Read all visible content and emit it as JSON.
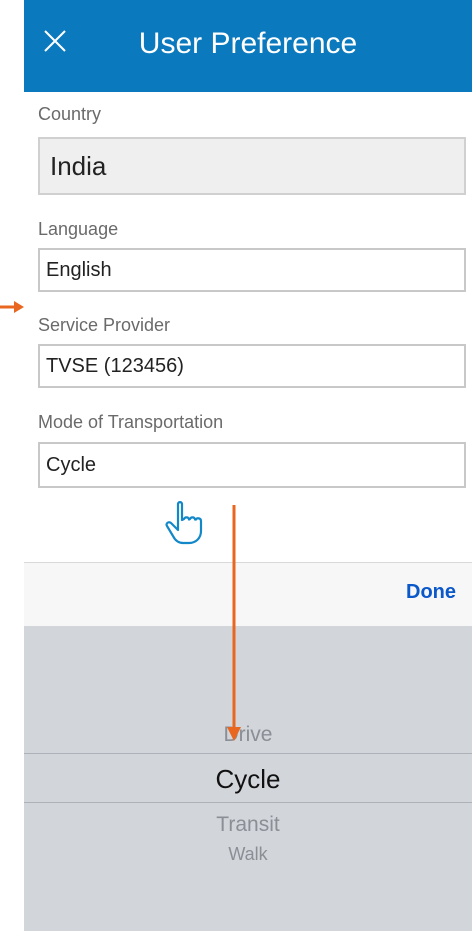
{
  "header": {
    "title": "User Preference",
    "close_icon": "close-icon"
  },
  "form": {
    "country": {
      "label": "Country",
      "value": "India"
    },
    "language": {
      "label": "Language",
      "value": "English"
    },
    "service_provider": {
      "label": "Service Provider",
      "value": "TVSE (123456)"
    },
    "transport": {
      "label": "Mode of Transportation",
      "value": "Cycle"
    }
  },
  "toolbar": {
    "done_label": "Done"
  },
  "picker": {
    "options": [
      "Drive",
      "Cycle",
      "Transit",
      "Walk"
    ],
    "selected": "Cycle"
  },
  "annotations": {
    "hand_icon": "pointing-hand-icon",
    "arrow_color": "#e8661f"
  },
  "colors": {
    "header_bg": "#0a79bd",
    "done": "#0a58c9",
    "picker_bg": "#d2d5da"
  }
}
